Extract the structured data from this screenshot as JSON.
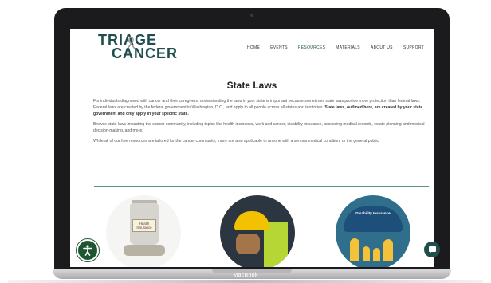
{
  "device": {
    "model_label": "MacBook"
  },
  "site": {
    "logo": {
      "line1": "TRIAGE",
      "line2": "CANCER"
    },
    "nav": [
      {
        "label": "HOME"
      },
      {
        "label": "EVENTS"
      },
      {
        "label": "RESOURCES",
        "active": true
      },
      {
        "label": "MATERIALS"
      },
      {
        "label": "ABOUT US"
      },
      {
        "label": "SUPPORT"
      }
    ]
  },
  "page": {
    "title": "State Laws",
    "paragraph1_normal": "For individuals diagnosed with cancer and their caregivers, understanding the laws in your state is important because sometimes state laws provide more protection than federal laws. Federal laws are created by the federal government in Washington, D.C., and apply to all people across all states and territories. ",
    "paragraph1_bold": "State laws, outlined here, are created by your state government and only apply in your specific state.",
    "paragraph2": "Browse state laws impacting the cancer community, including topics like health insurance, work and cancer, disability insurance, accessing medical records, estate planning and medical decision-making, and more.",
    "paragraph3": "While all of our free resources are tailored for the cancer community, many are also applicable to anyone with a serious medical condition, or the general public."
  },
  "cards": [
    {
      "image_icon": "health-insurance-jar-icon",
      "image_text": "Health Insurance"
    },
    {
      "image_icon": "hard-hat-worker-icon"
    },
    {
      "image_icon": "disability-insurance-umbrella-icon",
      "image_text": "Disability Insurance"
    }
  ],
  "floating": {
    "accessibility_icon": "accessibility-icon",
    "chat_icon": "chat-bubble-icon"
  },
  "colors": {
    "brand": "#1f4e4d",
    "accessibility": "#1e5631",
    "divider": "#5f8f8c"
  }
}
